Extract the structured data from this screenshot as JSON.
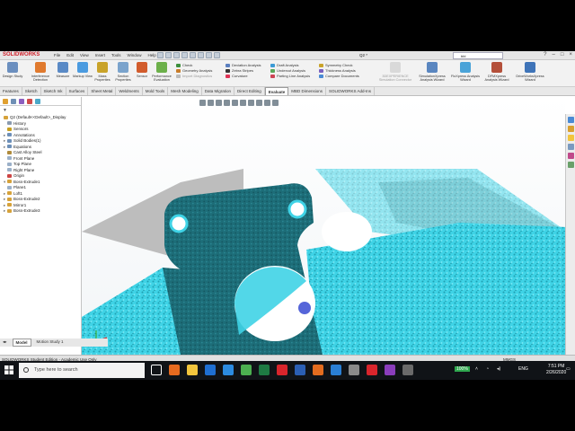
{
  "app": {
    "brand": "SOLIDWORKS",
    "document_title": "Q2 *",
    "menus": [
      "File",
      "Edit",
      "View",
      "Insert",
      "Tools",
      "Window",
      "Help"
    ],
    "search_placeholder": "bbl"
  },
  "ribbon": {
    "big_buttons": [
      {
        "label": "Design Study",
        "color": "#6b8fbf"
      },
      {
        "label": "Interference Detection",
        "color": "#e07a2e"
      },
      {
        "label": "Measure",
        "color": "#5a8ac6"
      },
      {
        "label": "Markup View",
        "color": "#4b9be0"
      },
      {
        "label": "Mass Properties",
        "color": "#c9a32a"
      },
      {
        "label": "Section Properties",
        "color": "#7aa3cc"
      },
      {
        "label": "Sensor",
        "color": "#d25c2c"
      },
      {
        "label": "Performance Evaluation",
        "color": "#6cb04a"
      }
    ],
    "small_col1": [
      "Check",
      "Geometry Analysis",
      "Import Diagnostics"
    ],
    "small_col2": [
      "Deviation Analysis",
      "Zebra Stripes",
      "Curvature"
    ],
    "small_col3": [
      "Draft Analysis",
      "Undercut Analysis",
      "Parting Line Analysis"
    ],
    "small_col4": [
      "Symmetry Check",
      "Thickness Analysis",
      "Compare Documents"
    ],
    "right_buttons": [
      "3DEXPERIENCE Simulation Connector",
      "SimulationXpress Analysis Wizard",
      "FloXpress Analysis Wizard",
      "DFMXpress Analysis Wizard",
      "DriveWorksXpress Wizard"
    ]
  },
  "tabs": [
    "Features",
    "Sketch",
    "Sketch Ink",
    "Surfaces",
    "Sheet Metal",
    "Weldments",
    "Mold Tools",
    "Mesh Modeling",
    "Data Migration",
    "Direct Editing",
    "Evaluate",
    "MBD Dimensions",
    "SOLIDWORKS Add-Ins"
  ],
  "active_tab": "Evaluate",
  "feature_tree": {
    "root": "Q2  (Default<<Default>_Display",
    "items": [
      {
        "label": "History",
        "color": "#8a9bb0",
        "exp": ""
      },
      {
        "label": "Sensors",
        "color": "#c8a020",
        "exp": ""
      },
      {
        "label": "Annotations",
        "color": "#6d8fb8",
        "exp": "▸"
      },
      {
        "label": "Solid Bodies(1)",
        "color": "#6d8fb8",
        "exp": "▸"
      },
      {
        "label": "Equations",
        "color": "#6d8fb8",
        "exp": "▸"
      },
      {
        "label": "Cast Alloy Steel",
        "color": "#b08b3c",
        "exp": ""
      },
      {
        "label": "Front Plane",
        "color": "#9bb0c8",
        "exp": ""
      },
      {
        "label": "Top Plane",
        "color": "#9bb0c8",
        "exp": ""
      },
      {
        "label": "Right Plane",
        "color": "#9bb0c8",
        "exp": ""
      },
      {
        "label": "Origin",
        "color": "#c44",
        "exp": ""
      },
      {
        "label": "Boss-Extrude1",
        "color": "#d6a23a",
        "exp": "▾"
      },
      {
        "label": "Plane1",
        "color": "#9bb0c8",
        "exp": ""
      },
      {
        "label": "Loft1",
        "color": "#d6a23a",
        "exp": "▸"
      },
      {
        "label": "Boss-Extrude2",
        "color": "#d6a23a",
        "exp": "▸"
      },
      {
        "label": "Mirror1",
        "color": "#d6a23a",
        "exp": "▸"
      },
      {
        "label": "Boss-Extrude3",
        "color": "#d6a23a",
        "exp": "▸"
      }
    ]
  },
  "bottom_tabs": [
    "Model",
    "Motion Study 1"
  ],
  "status": {
    "text": "SOLIDWORKS Student Edition - Academic Use Only",
    "units": "MMGS"
  },
  "taskbar": {
    "search_placeholder": "Type here to search",
    "battery": "100%",
    "lang": "ENG",
    "time": "7:51 PM",
    "date": "2/26/2020",
    "apps": [
      {
        "name": "task-view-icon",
        "color": "#ffffff"
      },
      {
        "name": "firefox-icon",
        "color": "#e66a1f"
      },
      {
        "name": "file-explorer-icon",
        "color": "#f2c53d"
      },
      {
        "name": "mail-icon",
        "color": "#1f6fd1"
      },
      {
        "name": "edge-icon",
        "color": "#2c8be0"
      },
      {
        "name": "chrome-icon",
        "color": "#4caf50"
      },
      {
        "name": "excel-icon",
        "color": "#1e7a43"
      },
      {
        "name": "solidworks-icon",
        "color": "#d9252c"
      },
      {
        "name": "word-icon",
        "color": "#2b5fb4"
      },
      {
        "name": "matlab-icon",
        "color": "#e36c1f"
      },
      {
        "name": "photos-icon",
        "color": "#2a7fd4"
      },
      {
        "name": "settings-icon",
        "color": "#8a8a8a"
      },
      {
        "name": "sw-2-icon",
        "color": "#d9252c"
      },
      {
        "name": "onenote-icon",
        "color": "#8a3dbb"
      },
      {
        "name": "calculator-icon",
        "color": "#6a6a6a"
      }
    ]
  },
  "colors": {
    "model": "#3fd3e6",
    "model_dark": "#1f7f8b",
    "accent": "#d9252c"
  }
}
